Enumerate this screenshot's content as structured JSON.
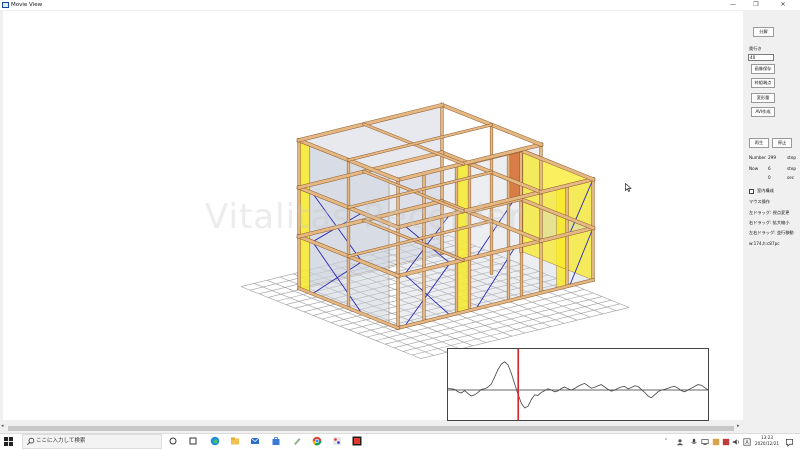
{
  "window": {
    "title": "Movie View",
    "minimize": "—",
    "maximize": "❐",
    "close": "✕"
  },
  "watermark": "Vitalitas Recorder",
  "sidebar": {
    "separate_button": "分解",
    "depth_label": "奥行き",
    "depth_value": "40",
    "save_image_button": "画像保存",
    "frame_button": "枠組端点",
    "deform_button": "変形量",
    "avi_button": "AVI作成",
    "play_button": "再生",
    "stop_button": "停止",
    "number_label": "Number",
    "number_value": "299",
    "number_unit": "step",
    "now_label": "Now",
    "now_value": "6",
    "now_unit": "step",
    "time_value": "0",
    "time_unit": "sec",
    "indoor_checkbox_label": "室内構成",
    "mouse_heading": "マウス操作",
    "mouse_left": "左ドラッグ: 視点変更",
    "mouse_right": "右ドラッグ: 拡大縮小",
    "mouse_both": "左右ドラッグ: 並行移動",
    "status": "w:174,h:c87pc"
  },
  "waveform": {
    "values": [
      0.05,
      0.04,
      0.02,
      -0.06,
      -0.1,
      -0.02,
      -0.12,
      -0.2,
      -0.16,
      -0.08,
      0.02,
      0.04,
      0.1,
      0.2,
      0.44,
      0.68,
      0.86,
      0.94,
      0.84,
      0.56,
      0.2,
      -0.14,
      -0.44,
      -0.6,
      -0.54,
      -0.32,
      -0.16,
      -0.18,
      -0.08,
      -0.02,
      0.04,
      0.0,
      -0.06,
      -0.03,
      0.05,
      0.1,
      0.04,
      0.0,
      0.05,
      0.12,
      0.18,
      0.22,
      0.14,
      0.06,
      0.09,
      0.14,
      0.18,
      0.1,
      0.02,
      -0.04,
      0.0,
      0.06,
      0.1,
      0.12,
      0.04,
      0.08,
      0.14,
      0.12,
      0.02,
      -0.08,
      -0.2,
      -0.26,
      -0.16,
      -0.06,
      0.0,
      0.02,
      0.06,
      0.1,
      0.12,
      0.06,
      -0.02,
      -0.06,
      0.0,
      0.06,
      0.12,
      0.18,
      0.16,
      0.08,
      0.0
    ],
    "marker_fraction": 0.27,
    "line_color": "#444444",
    "marker_color": "#e0232a"
  },
  "taskbar": {
    "search_placeholder": "ここに入力して検索",
    "time": "13:23",
    "date": "2020/12/21"
  },
  "colors": {
    "beam": "#e5b783",
    "beam_edge": "#8b5a2b",
    "yellow_panel": "#f7ea2a",
    "orange_panel": "#d6692a",
    "glass_panel": "#c9cfda",
    "brace": "#2a2ab3",
    "grid": "#9e9e9e"
  }
}
